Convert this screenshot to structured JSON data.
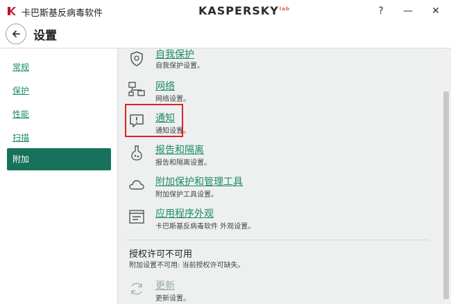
{
  "window": {
    "app_title": "卡巴斯基反病毒软件",
    "brand": "KASPERSKY",
    "brand_sup": "lab",
    "help_label": "?",
    "minimize_label": "—",
    "close_label": "✕"
  },
  "header": {
    "title": "设置"
  },
  "sidebar": {
    "items": [
      {
        "label": "常规"
      },
      {
        "label": "保护"
      },
      {
        "label": "性能"
      },
      {
        "label": "扫描"
      },
      {
        "label": "附加"
      }
    ],
    "active": "附加"
  },
  "main": {
    "items": [
      {
        "title": "自我保护",
        "desc": "自我保护设置。",
        "icon": "shield-icon"
      },
      {
        "title": "网络",
        "desc": "网络设置。",
        "icon": "network-icon"
      },
      {
        "title": "通知",
        "desc": "通知设置。",
        "icon": "notification-icon"
      },
      {
        "title": "报告和隔离",
        "desc": "报告和隔离设置。",
        "icon": "flask-icon"
      },
      {
        "title": "附加保护和管理工具",
        "desc": "附加保护工具设置。",
        "icon": "cloud-icon"
      },
      {
        "title": "应用程序外观",
        "desc": "卡巴斯基反病毒软件 外观设置。",
        "icon": "appearance-icon"
      }
    ],
    "license_section": {
      "title": "授权许可不可用",
      "desc": "附加设置不可用: 当前授权许可缺失。"
    },
    "update_item": {
      "title": "更新",
      "desc": "更新设置。",
      "icon": "refresh-icon"
    }
  },
  "colors": {
    "accent": "#17725c",
    "link": "#1d8a6a",
    "highlight": "#e02020",
    "content_bg": "#eef0f0"
  }
}
